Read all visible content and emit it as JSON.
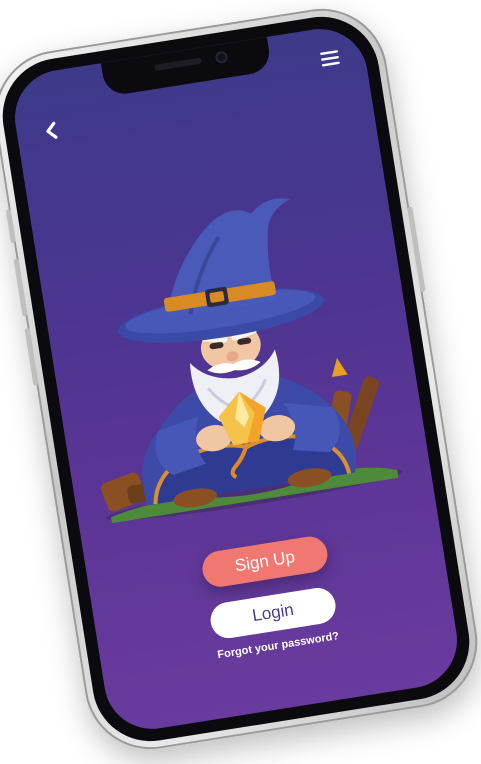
{
  "screen": {
    "nav": {
      "back_icon": "chevron-left-icon",
      "menu_icon": "hamburger-menu-icon"
    },
    "hero": {
      "illustration": "wizard-holding-crystal"
    },
    "actions": {
      "signup_label": "Sign Up",
      "login_label": "Login",
      "forgot_label": "Forgot your password?"
    },
    "colors": {
      "bg_top": "#3d3a8a",
      "bg_bottom": "#6a3b9e",
      "signup_bg": "#f07870",
      "login_bg": "#ffffff",
      "login_text": "#4a3a96"
    }
  }
}
